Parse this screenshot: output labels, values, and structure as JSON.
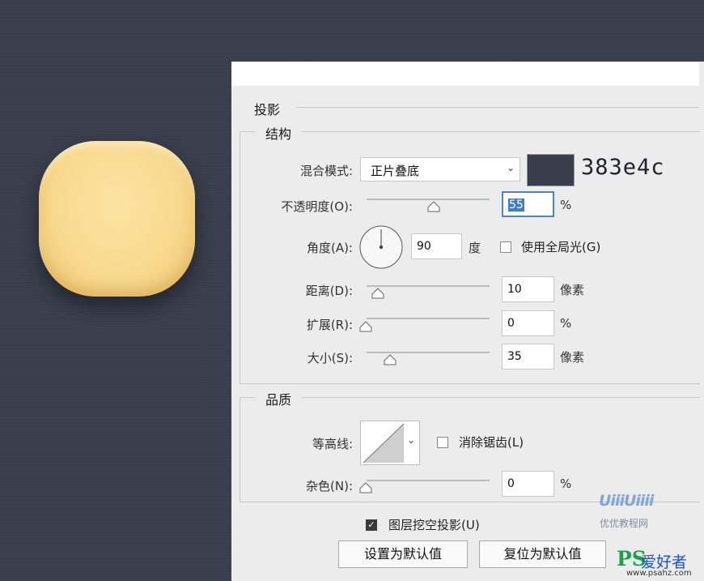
{
  "canvas": {
    "background_color": "#383e4c",
    "icon_color": "#f8d98f"
  },
  "color_note": "383e4c",
  "dialog": {
    "section_title": "投影",
    "structure": {
      "title": "结构",
      "blend_mode": {
        "label": "混合模式:",
        "value": "正片叠底",
        "color": "#383e4c"
      },
      "opacity": {
        "label": "不透明度(O):",
        "value": "55",
        "unit": "%",
        "slider_fraction": 0.55
      },
      "angle": {
        "label": "角度(A):",
        "value": "90",
        "unit": "度",
        "use_global_light": {
          "label": "使用全局光(G)",
          "checked": false
        }
      },
      "distance": {
        "label": "距离(D):",
        "value": "10",
        "unit": "像素",
        "slider_fraction": 0.07
      },
      "spread": {
        "label": "扩展(R):",
        "value": "0",
        "unit": "%",
        "slider_fraction": 0.0
      },
      "size": {
        "label": "大小(S):",
        "value": "35",
        "unit": "像素",
        "slider_fraction": 0.2
      }
    },
    "quality": {
      "title": "品质",
      "contour": {
        "label": "等高线:",
        "anti_alias": {
          "label": "消除锯齿(L)",
          "checked": false
        }
      },
      "noise": {
        "label": "杂色(N):",
        "value": "0",
        "unit": "%",
        "slider_fraction": 0.0
      }
    },
    "layer_knocks_out": {
      "label": "图层挖空投影(U)",
      "checked": true
    },
    "buttons": {
      "make_default": "设置为默认值",
      "reset_default": "复位为默认值"
    }
  },
  "watermarks": {
    "uiiii_logo": "UiiiUiiii",
    "uiiii_text": "优优教程网",
    "ps_logo": "PS",
    "ps_text": "爱好者",
    "ps_url": "www.psahz.com"
  }
}
